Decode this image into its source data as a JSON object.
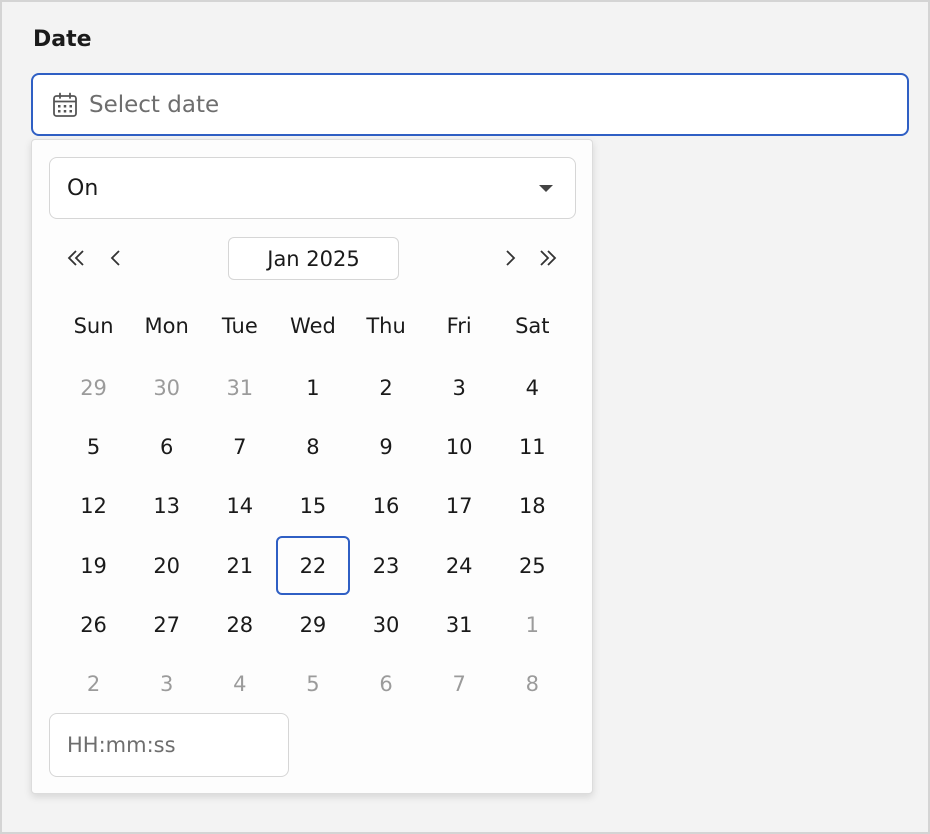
{
  "field": {
    "label": "Date",
    "placeholder": "Select date"
  },
  "picker": {
    "mode": "On",
    "month_label": "Jan 2025",
    "weekdays": [
      "Sun",
      "Mon",
      "Tue",
      "Wed",
      "Thu",
      "Fri",
      "Sat"
    ],
    "weeks": [
      [
        "29",
        "30",
        "31",
        "1",
        "2",
        "3",
        "4"
      ],
      [
        "5",
        "6",
        "7",
        "8",
        "9",
        "10",
        "11"
      ],
      [
        "12",
        "13",
        "14",
        "15",
        "16",
        "17",
        "18"
      ],
      [
        "19",
        "20",
        "21",
        "22",
        "23",
        "24",
        "25"
      ],
      [
        "26",
        "27",
        "28",
        "29",
        "30",
        "31",
        "1"
      ],
      [
        "2",
        "3",
        "4",
        "5",
        "6",
        "7",
        "8"
      ]
    ],
    "selected_day": "22",
    "time_placeholder": "HH:mm:ss"
  },
  "colors": {
    "accent": "#2f5fc4",
    "muted_day": "#9b9b9b"
  },
  "icons": {
    "input": "calendar-icon",
    "prev_year": "double-chevron-left-icon",
    "prev_month": "chevron-left-icon",
    "next_month": "chevron-right-icon",
    "next_year": "double-chevron-right-icon",
    "dropdown": "caret-down-icon"
  }
}
